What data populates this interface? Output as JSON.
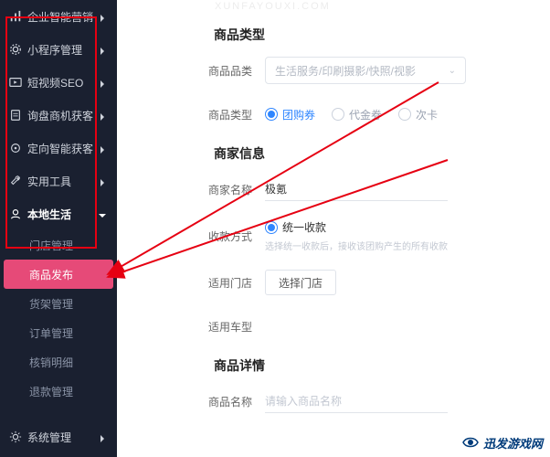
{
  "sidebar": {
    "items": [
      {
        "label": "企业智能营销",
        "icon": "bars-icon"
      },
      {
        "label": "小程序管理",
        "icon": "gear-icon"
      },
      {
        "label": "短视频SEO",
        "icon": "play-icon"
      },
      {
        "label": "询盘商机获客",
        "icon": "doc-icon"
      },
      {
        "label": "定向智能获客",
        "icon": "target-icon"
      },
      {
        "label": "实用工具",
        "icon": "wrench-icon"
      },
      {
        "label": "本地生活",
        "icon": "life-icon"
      }
    ],
    "submenu": [
      {
        "label": "门店管理"
      },
      {
        "label": "商品发布",
        "selected": true
      },
      {
        "label": "货架管理"
      },
      {
        "label": "订单管理"
      },
      {
        "label": "核销明细"
      },
      {
        "label": "退款管理"
      }
    ],
    "footer": {
      "label": "系统管理",
      "icon": "gear-icon"
    }
  },
  "content": {
    "sec1": {
      "title": "商品类型"
    },
    "category": {
      "label": "商品品类",
      "placeholder": "生活服务/印刷摄影/快照/视影"
    },
    "ptype": {
      "label": "商品类型",
      "options": [
        "团购券",
        "代金券",
        "次卡"
      ],
      "selected": 0
    },
    "sec2": {
      "title": "商家信息"
    },
    "merchant": {
      "label": "商家名称",
      "value": "极氪"
    },
    "payment": {
      "label": "收款方式",
      "option": "统一收款",
      "hint": "选择统一收款后，接收该团购产生的所有收款"
    },
    "store": {
      "label": "适用门店",
      "button": "选择门店"
    },
    "vehicle": {
      "label": "适用车型"
    },
    "sec3": {
      "title": "商品详情"
    },
    "pname": {
      "label": "商品名称",
      "placeholder": "请输入商品名称"
    }
  },
  "watermark": {
    "top": "XUNFAYOUXI.COM",
    "bottom": "迅发游戏网"
  }
}
